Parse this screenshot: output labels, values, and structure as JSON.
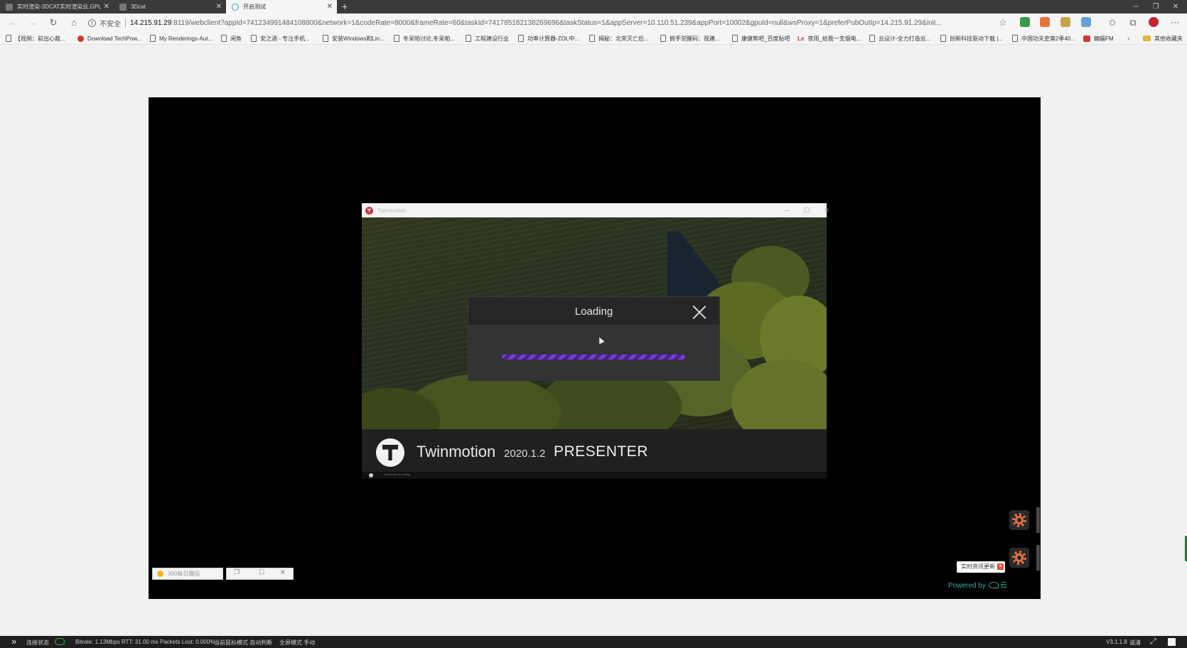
{
  "browser": {
    "tabs": [
      {
        "label": "实时渲染-3DCAT实时渲染云,GPU",
        "active": false
      },
      {
        "label": "3Dcat",
        "active": false
      },
      {
        "label": "开启测试",
        "active": true
      }
    ],
    "new_tab": "+",
    "address": {
      "security_label": "不安全",
      "host": "14.215.91.29",
      "path": ":8119/webclient?appId=741234991484108800&network=1&codeRate=8000&frameRate=60&taskId=741785182138269696&taskStatus=1&appServer=10.110.51.239&appPort=10002&gpuId=null&wsProxy=1&preferPubOutIp=14.215.91.29&init..."
    },
    "bookmarks": [
      {
        "label": "【视频：前出心裁...",
        "icon": "page"
      },
      {
        "label": "Download TechPow...",
        "icon": "red"
      },
      {
        "label": "My Renderings-Aut...",
        "icon": "page"
      },
      {
        "label": "闲鱼",
        "icon": "page"
      },
      {
        "label": "安之酒 - 专注手机...",
        "icon": "page"
      },
      {
        "label": "安装Windows和Lin...",
        "icon": "page"
      },
      {
        "label": "冬呆帕讨论,冬呆帕...",
        "icon": "page"
      },
      {
        "label": "工程建设行业",
        "icon": "page"
      },
      {
        "label": "功率计算器-ZOL中...",
        "icon": "page"
      },
      {
        "label": "揭秘：北宋灭亡后...",
        "icon": "page"
      },
      {
        "label": "俯手觉醒码：视建...",
        "icon": "page"
      },
      {
        "label": "康健熊吧_百度贴吧",
        "icon": "page"
      },
      {
        "label": "夜雨_给我一支烟电...",
        "icon": "le"
      },
      {
        "label": "云设计-全力打造云...",
        "icon": "page"
      },
      {
        "label": "创新科技驱动下载 |...",
        "icon": "page"
      },
      {
        "label": "中国功夫史第2季40...",
        "icon": "page"
      },
      {
        "label": "蝙蝠FM",
        "icon": "ping"
      }
    ],
    "other_bookmarks": "其他收藏夹"
  },
  "app_window": {
    "title": "Twinmotion",
    "brand": "Twinmotion",
    "version": "2020.1.2",
    "edition": "PRESENTER",
    "status_text": "Twinmotion is loading"
  },
  "loading_dialog": {
    "title": "Loading",
    "progress": 1.0
  },
  "overlay": {
    "news_badge": "实时资讯更新",
    "powered_by": "Powered by",
    "powered_brand": "云"
  },
  "taskbar_windows": [
    {
      "label": "360每日趣玩"
    }
  ],
  "status_bar": {
    "connection_label": "连接状态",
    "metrics": "Bitrate: 1.13Mbps RTT: 31.00 ms Packets Lost: 0.000%",
    "mouse_mode": "当前鼠标模式 自动判断",
    "fullscreen_mode": "全屏模式 手动",
    "version": "V3.1.1.8",
    "quality": "诚清"
  },
  "colors": {
    "accent_progress": "#7a3bd6",
    "powered_teal": "#2fb0a8",
    "gear_orange": "#e0703a"
  }
}
